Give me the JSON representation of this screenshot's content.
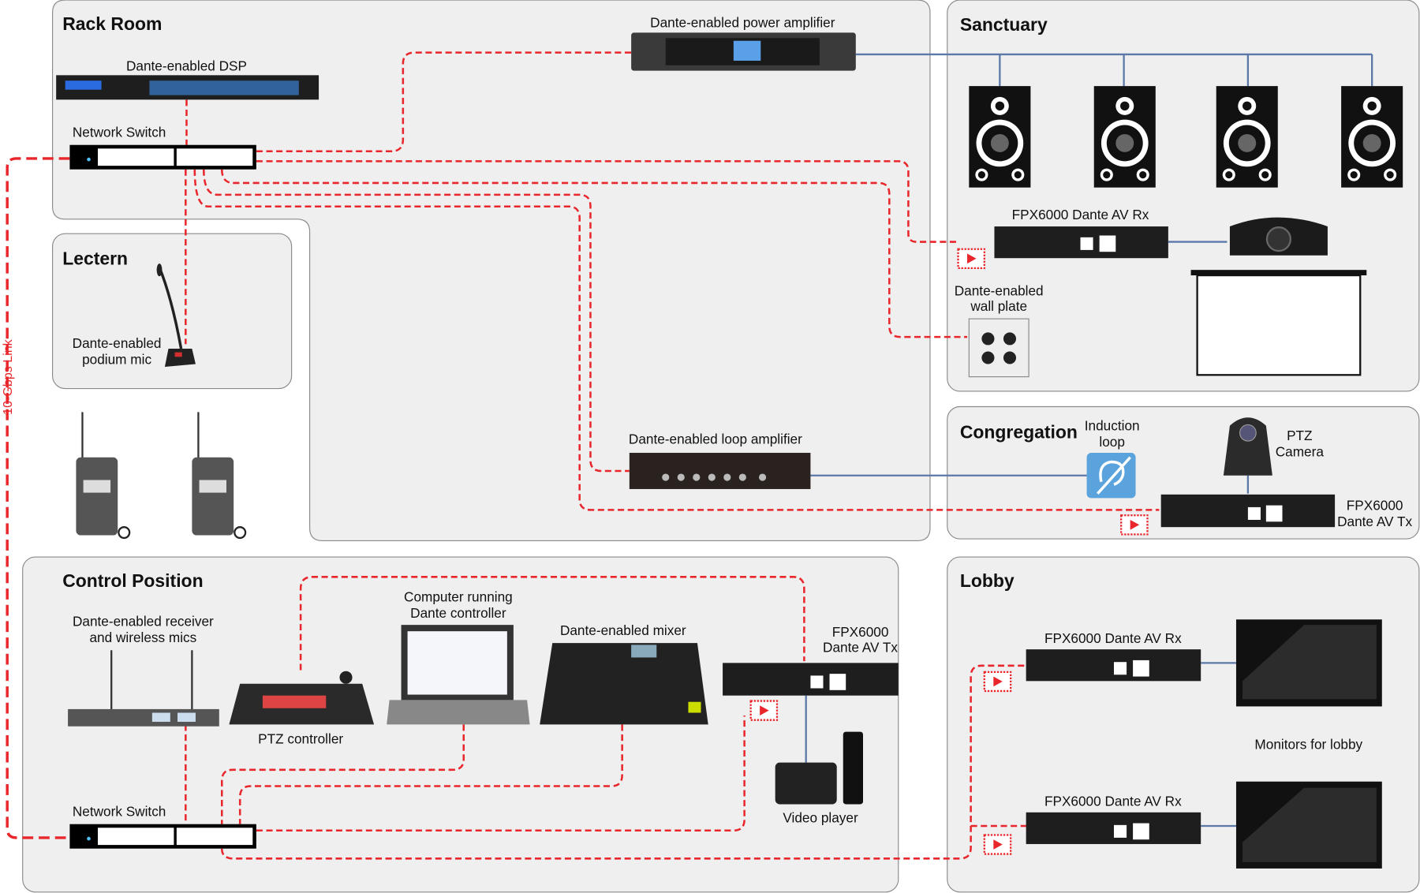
{
  "colors": {
    "dante_link": "#e8262b",
    "av_link": "#5b78a8",
    "panel": "#efefef"
  },
  "zones": {
    "rack_room": "Rack Room",
    "lectern": "Lectern",
    "sanctuary": "Sanctuary",
    "congregation": "Congregation",
    "control_position": "Control Position",
    "lobby": "Lobby"
  },
  "link_label": "10-Gbps Link",
  "devices": {
    "dsp": "Dante-enabled DSP",
    "switch_rack": "Network Switch",
    "power_amp": "Dante-enabled power amplifier",
    "podium_mic_1": "Dante-enabled",
    "podium_mic_2": "podium mic",
    "loop_amp": "Dante-enabled loop amplifier",
    "rx_sanctuary": "FPX6000 Dante AV Rx",
    "wall_plate_1": "Dante-enabled",
    "wall_plate_2": "wall plate",
    "induction_1": "Induction",
    "induction_2": "loop",
    "ptz_camera_1": "PTZ",
    "ptz_camera_2": "Camera",
    "tx_congregation_1": "FPX6000",
    "tx_congregation_2": "Dante AV Tx",
    "receiver_1": "Dante-enabled receiver",
    "receiver_2": "and wireless mics",
    "ptz_controller": "PTZ controller",
    "computer_1": "Computer running",
    "computer_2": "Dante controller",
    "mixer": "Dante-enabled mixer",
    "tx_control_1": "FPX6000",
    "tx_control_2": "Dante AV Tx",
    "video_player": "Video player",
    "switch_control": "Network Switch",
    "rx_lobby_1": "FPX6000 Dante AV Rx",
    "rx_lobby_2": "FPX6000 Dante AV Rx",
    "monitors": "Monitors for lobby"
  }
}
